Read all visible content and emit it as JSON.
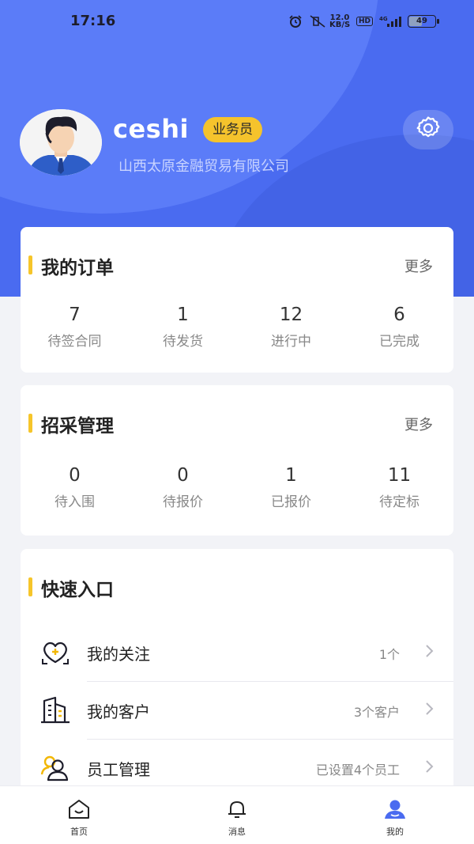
{
  "status_bar": {
    "time": "17:16",
    "net_speed": "12.0 KB/S",
    "hd": "HD",
    "signal": "4G",
    "battery": "49"
  },
  "profile": {
    "avatar_icon": "user-avatar",
    "username": "ceshi",
    "role": "业务员",
    "company": "山西太原金融贸易有限公司",
    "settings_icon": "gear-icon"
  },
  "orders": {
    "title": "我的订单",
    "more": "更多",
    "stats": [
      {
        "value": "7",
        "label": "待签合同"
      },
      {
        "value": "1",
        "label": "待发货"
      },
      {
        "value": "12",
        "label": "进行中"
      },
      {
        "value": "6",
        "label": "已完成"
      }
    ]
  },
  "procurement": {
    "title": "招采管理",
    "more": "更多",
    "stats": [
      {
        "value": "0",
        "label": "待入围"
      },
      {
        "value": "0",
        "label": "待报价"
      },
      {
        "value": "1",
        "label": "已报价"
      },
      {
        "value": "11",
        "label": "待定标"
      }
    ]
  },
  "quick": {
    "title": "快速入口",
    "items": [
      {
        "icon": "heart-icon",
        "label": "我的关注",
        "value": "1个"
      },
      {
        "icon": "building-icon",
        "label": "我的客户",
        "value": "3个客户"
      },
      {
        "icon": "users-icon",
        "label": "员工管理",
        "value": "已设置4个员工"
      }
    ]
  },
  "tabbar": {
    "items": [
      {
        "icon": "home-icon",
        "label": "首页"
      },
      {
        "icon": "bell-icon",
        "label": "消息"
      },
      {
        "icon": "profile-icon",
        "label": "我的"
      }
    ],
    "active": "我的"
  },
  "colors": {
    "brand": "#4a6bf0",
    "accent": "#f6c52a"
  }
}
